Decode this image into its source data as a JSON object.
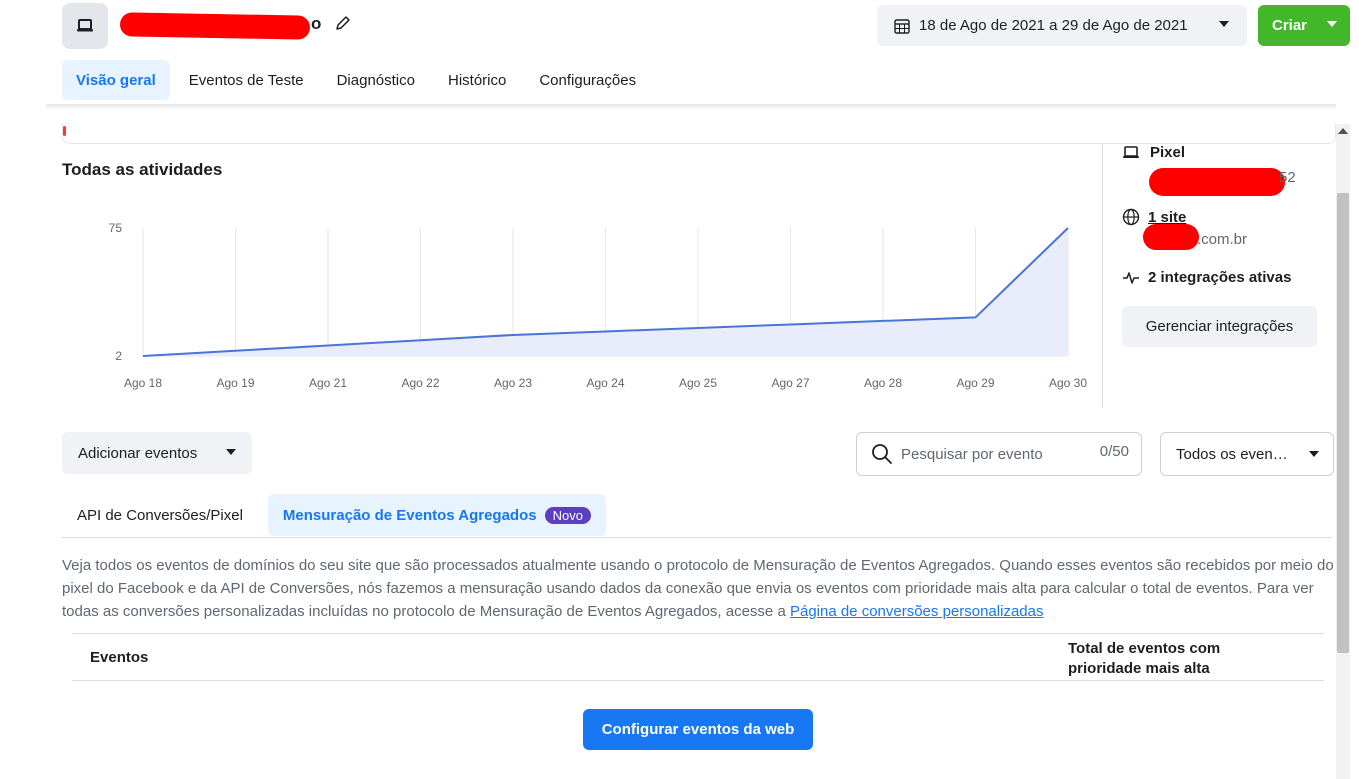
{
  "header": {
    "title_visible": "o",
    "date_range": "18 de Ago de 2021 a 29 de Ago de 2021",
    "create_label": "Criar"
  },
  "tabs": [
    {
      "label": "Visão geral",
      "active": true
    },
    {
      "label": "Eventos de Teste",
      "active": false
    },
    {
      "label": "Diagnóstico",
      "active": false
    },
    {
      "label": "Histórico",
      "active": false
    },
    {
      "label": "Configurações",
      "active": false
    }
  ],
  "activity": {
    "title": "Todas as atividades"
  },
  "chart_data": {
    "type": "area",
    "title": "Todas as atividades",
    "categories": [
      "Ago 18",
      "Ago 19",
      "Ago 21",
      "Ago 22",
      "Ago 23",
      "Ago 24",
      "Ago 25",
      "Ago 27",
      "Ago 28",
      "Ago 29",
      "Ago 30"
    ],
    "series": [
      {
        "values": [
          2,
          5,
          8,
          11,
          14,
          16,
          18,
          20,
          22,
          24,
          75
        ]
      }
    ],
    "yticks": [
      2,
      75
    ],
    "ylim": [
      2,
      75
    ],
    "grid": "vertical",
    "color": "#4a74d6",
    "fill": "#e9ecfa"
  },
  "side_panel": {
    "pixel_label": "Pixel",
    "pixel_id_visible": "52",
    "site_label": "1 site",
    "site_domain_visible": ".com.br",
    "integrations_label": "2 integrações ativas",
    "manage_label": "Gerenciar integrações"
  },
  "controls": {
    "add_events_label": "Adicionar eventos",
    "search_placeholder": "Pesquisar por evento",
    "search_count": "0/50",
    "filter_label": "Todos os even…"
  },
  "sub_tabs": {
    "tab1": "API de Conversões/Pixel",
    "tab2": "Mensuração de Eventos Agregados",
    "badge": "Novo"
  },
  "description": {
    "text": "Veja todos os eventos de domínios do seu site que são processados atualmente usando o protocolo de Mensuração de Eventos Agregados. Quando esses eventos são recebidos por meio do pixel do Facebook e da API de Conversões, nós fazemos a mensuração usando dados da conexão que envia os eventos com prioridade mais alta para calcular o total de eventos. Para ver todas as conversões personalizadas incluídas no protocolo de Mensuração de Eventos Agregados, acesse a ",
    "link": "Página de conversões personalizadas"
  },
  "table": {
    "col_events": "Eventos",
    "col_total": "Total de eventos com prioridade mais alta"
  },
  "config_button": "Configurar eventos da web"
}
